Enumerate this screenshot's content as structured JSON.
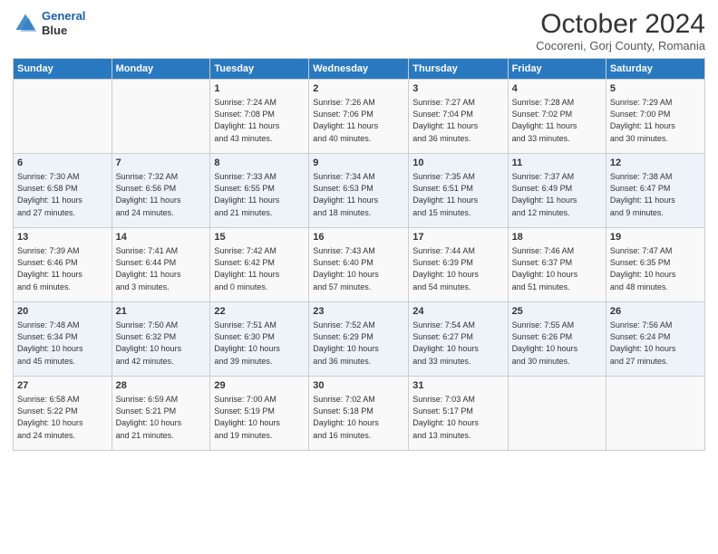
{
  "header": {
    "logo_line1": "General",
    "logo_line2": "Blue",
    "month": "October 2024",
    "location": "Cocoreni, Gorj County, Romania"
  },
  "columns": [
    "Sunday",
    "Monday",
    "Tuesday",
    "Wednesday",
    "Thursday",
    "Friday",
    "Saturday"
  ],
  "weeks": [
    [
      {
        "day": "",
        "info": ""
      },
      {
        "day": "",
        "info": ""
      },
      {
        "day": "1",
        "info": "Sunrise: 7:24 AM\nSunset: 7:08 PM\nDaylight: 11 hours\nand 43 minutes."
      },
      {
        "day": "2",
        "info": "Sunrise: 7:26 AM\nSunset: 7:06 PM\nDaylight: 11 hours\nand 40 minutes."
      },
      {
        "day": "3",
        "info": "Sunrise: 7:27 AM\nSunset: 7:04 PM\nDaylight: 11 hours\nand 36 minutes."
      },
      {
        "day": "4",
        "info": "Sunrise: 7:28 AM\nSunset: 7:02 PM\nDaylight: 11 hours\nand 33 minutes."
      },
      {
        "day": "5",
        "info": "Sunrise: 7:29 AM\nSunset: 7:00 PM\nDaylight: 11 hours\nand 30 minutes."
      }
    ],
    [
      {
        "day": "6",
        "info": "Sunrise: 7:30 AM\nSunset: 6:58 PM\nDaylight: 11 hours\nand 27 minutes."
      },
      {
        "day": "7",
        "info": "Sunrise: 7:32 AM\nSunset: 6:56 PM\nDaylight: 11 hours\nand 24 minutes."
      },
      {
        "day": "8",
        "info": "Sunrise: 7:33 AM\nSunset: 6:55 PM\nDaylight: 11 hours\nand 21 minutes."
      },
      {
        "day": "9",
        "info": "Sunrise: 7:34 AM\nSunset: 6:53 PM\nDaylight: 11 hours\nand 18 minutes."
      },
      {
        "day": "10",
        "info": "Sunrise: 7:35 AM\nSunset: 6:51 PM\nDaylight: 11 hours\nand 15 minutes."
      },
      {
        "day": "11",
        "info": "Sunrise: 7:37 AM\nSunset: 6:49 PM\nDaylight: 11 hours\nand 12 minutes."
      },
      {
        "day": "12",
        "info": "Sunrise: 7:38 AM\nSunset: 6:47 PM\nDaylight: 11 hours\nand 9 minutes."
      }
    ],
    [
      {
        "day": "13",
        "info": "Sunrise: 7:39 AM\nSunset: 6:46 PM\nDaylight: 11 hours\nand 6 minutes."
      },
      {
        "day": "14",
        "info": "Sunrise: 7:41 AM\nSunset: 6:44 PM\nDaylight: 11 hours\nand 3 minutes."
      },
      {
        "day": "15",
        "info": "Sunrise: 7:42 AM\nSunset: 6:42 PM\nDaylight: 11 hours\nand 0 minutes."
      },
      {
        "day": "16",
        "info": "Sunrise: 7:43 AM\nSunset: 6:40 PM\nDaylight: 10 hours\nand 57 minutes."
      },
      {
        "day": "17",
        "info": "Sunrise: 7:44 AM\nSunset: 6:39 PM\nDaylight: 10 hours\nand 54 minutes."
      },
      {
        "day": "18",
        "info": "Sunrise: 7:46 AM\nSunset: 6:37 PM\nDaylight: 10 hours\nand 51 minutes."
      },
      {
        "day": "19",
        "info": "Sunrise: 7:47 AM\nSunset: 6:35 PM\nDaylight: 10 hours\nand 48 minutes."
      }
    ],
    [
      {
        "day": "20",
        "info": "Sunrise: 7:48 AM\nSunset: 6:34 PM\nDaylight: 10 hours\nand 45 minutes."
      },
      {
        "day": "21",
        "info": "Sunrise: 7:50 AM\nSunset: 6:32 PM\nDaylight: 10 hours\nand 42 minutes."
      },
      {
        "day": "22",
        "info": "Sunrise: 7:51 AM\nSunset: 6:30 PM\nDaylight: 10 hours\nand 39 minutes."
      },
      {
        "day": "23",
        "info": "Sunrise: 7:52 AM\nSunset: 6:29 PM\nDaylight: 10 hours\nand 36 minutes."
      },
      {
        "day": "24",
        "info": "Sunrise: 7:54 AM\nSunset: 6:27 PM\nDaylight: 10 hours\nand 33 minutes."
      },
      {
        "day": "25",
        "info": "Sunrise: 7:55 AM\nSunset: 6:26 PM\nDaylight: 10 hours\nand 30 minutes."
      },
      {
        "day": "26",
        "info": "Sunrise: 7:56 AM\nSunset: 6:24 PM\nDaylight: 10 hours\nand 27 minutes."
      }
    ],
    [
      {
        "day": "27",
        "info": "Sunrise: 6:58 AM\nSunset: 5:22 PM\nDaylight: 10 hours\nand 24 minutes."
      },
      {
        "day": "28",
        "info": "Sunrise: 6:59 AM\nSunset: 5:21 PM\nDaylight: 10 hours\nand 21 minutes."
      },
      {
        "day": "29",
        "info": "Sunrise: 7:00 AM\nSunset: 5:19 PM\nDaylight: 10 hours\nand 19 minutes."
      },
      {
        "day": "30",
        "info": "Sunrise: 7:02 AM\nSunset: 5:18 PM\nDaylight: 10 hours\nand 16 minutes."
      },
      {
        "day": "31",
        "info": "Sunrise: 7:03 AM\nSunset: 5:17 PM\nDaylight: 10 hours\nand 13 minutes."
      },
      {
        "day": "",
        "info": ""
      },
      {
        "day": "",
        "info": ""
      }
    ]
  ]
}
